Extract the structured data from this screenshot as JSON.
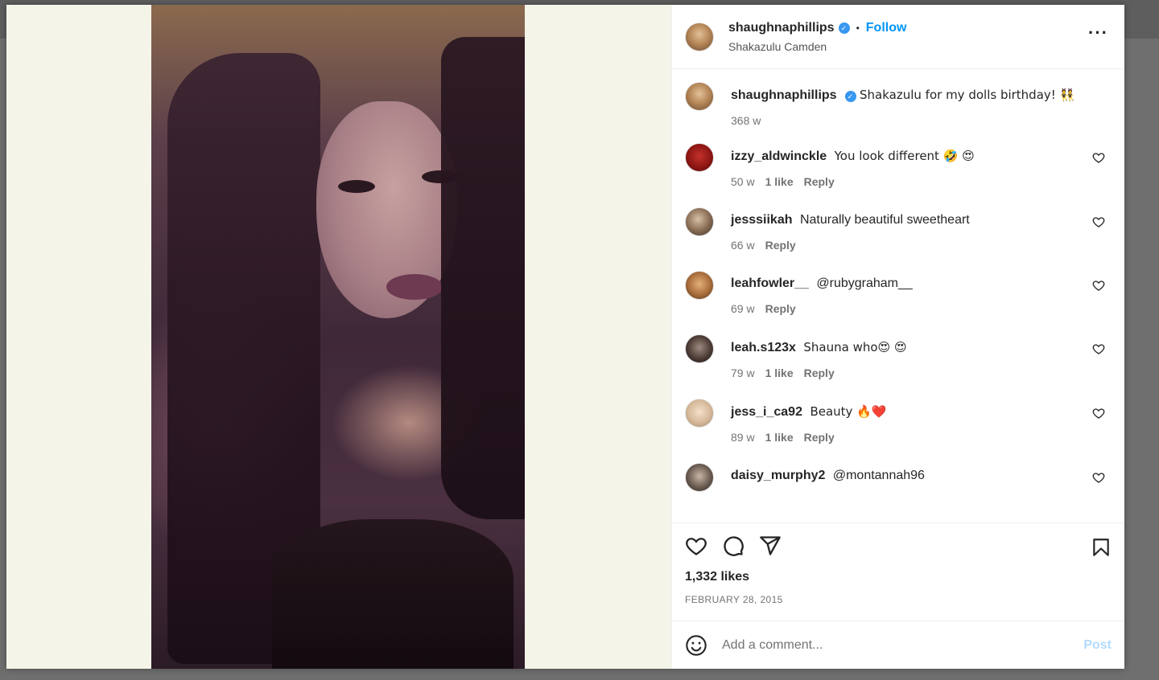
{
  "post": {
    "owner": "shaughnaphillips",
    "follow_label": "Follow",
    "separator": "•",
    "location": "Shakazulu Camden",
    "more_label": "···",
    "caption": "Shakazulu for my dolls birthday! 👯",
    "caption_age": "368 w",
    "likes": "1,332 likes",
    "date": "FEBRUARY 28, 2015"
  },
  "comments": [
    {
      "user": "izzy_aldwinckle",
      "text": "You look different 🤣 😍",
      "age": "50 w",
      "likes": "1 like",
      "reply": "Reply"
    },
    {
      "user": "jesssiikah",
      "text": "Naturally beautiful sweetheart",
      "age": "66 w",
      "likes": "",
      "reply": "Reply"
    },
    {
      "user": "leahfowler__",
      "text": "@rubygraham__",
      "age": "69 w",
      "likes": "",
      "reply": "Reply"
    },
    {
      "user": "leah.s123x",
      "text": "Shauna who😍 😍",
      "age": "79 w",
      "likes": "1 like",
      "reply": "Reply"
    },
    {
      "user": "jess_i_ca92",
      "text": "Beauty 🔥❤️",
      "age": "89 w",
      "likes": "1 like",
      "reply": "Reply"
    },
    {
      "user": "daisy_murphy2",
      "text": "@montannah96",
      "age": "",
      "likes": "",
      "reply": ""
    }
  ],
  "add_comment": {
    "placeholder": "Add a comment...",
    "post_label": "Post"
  },
  "colors": {
    "link": "#0095f6",
    "verified": "#3897f0",
    "post_disabled": "#b3dbff"
  }
}
